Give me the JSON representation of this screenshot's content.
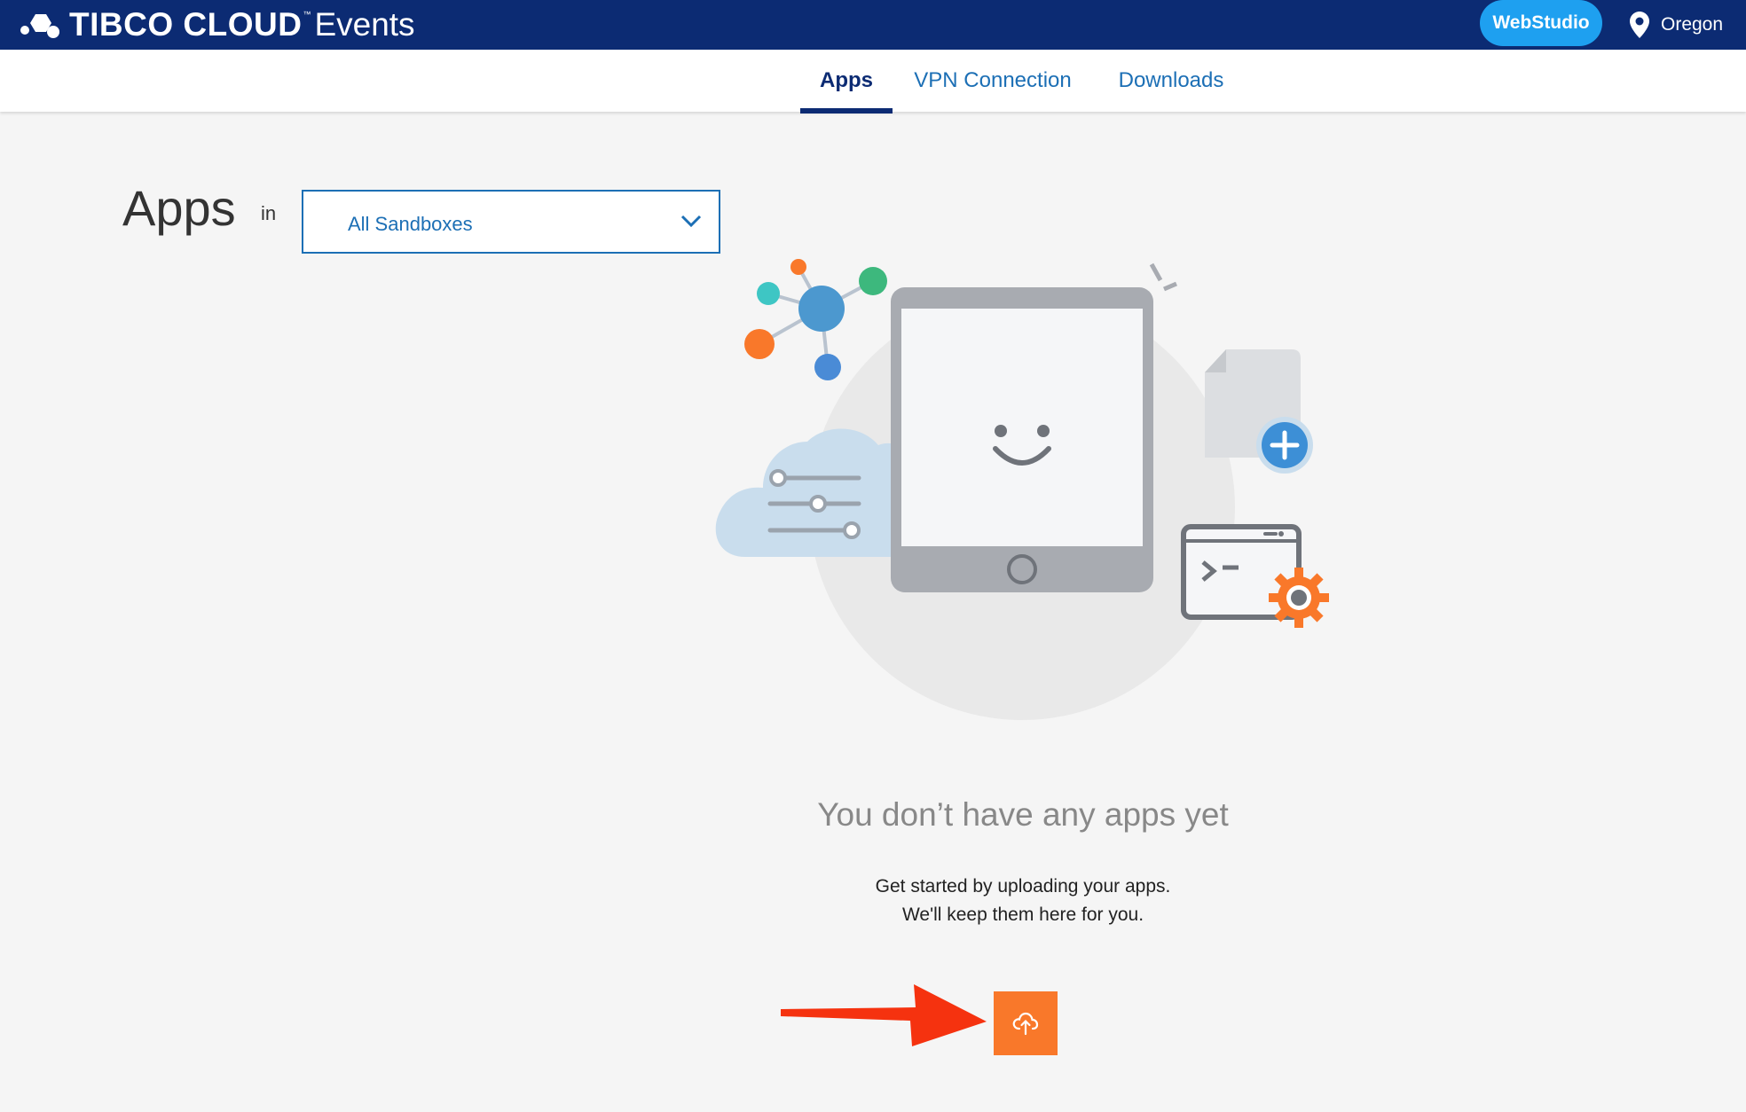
{
  "header": {
    "brand_main": "TIBCO CLOUD",
    "brand_tm": "™",
    "brand_product": "Events",
    "webstudio_label": "WebStudio",
    "region_label": "Oregon"
  },
  "tabs": [
    {
      "label": "Apps",
      "active": true
    },
    {
      "label": "VPN Connection",
      "active": false
    },
    {
      "label": "Downloads",
      "active": false
    }
  ],
  "main": {
    "title": "Apps",
    "in_label": "in",
    "sandbox_selected": "All Sandboxes",
    "empty_title": "You don’t have any apps yet",
    "empty_line1": "Get started by uploading your apps.",
    "empty_line2": "We'll keep them here for you."
  },
  "icons": {
    "upload": "cloud-upload-icon",
    "region": "location-pin-icon",
    "dropdown": "chevron-down-icon"
  },
  "colors": {
    "header_bg": "#0c2b73",
    "accent_blue": "#1ea0f0",
    "link_blue": "#1c6fb5",
    "upload_orange": "#f9782a",
    "annotation_red": "#f5320f"
  }
}
